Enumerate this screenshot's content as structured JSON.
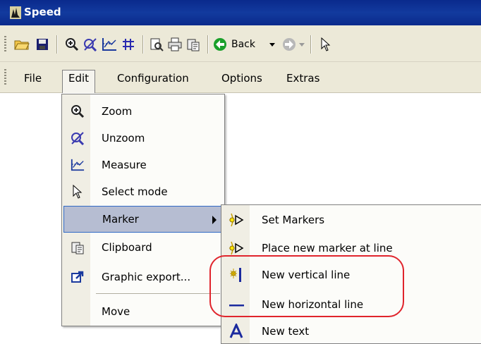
{
  "window": {
    "title": "Speed"
  },
  "toolbar": {
    "back_label": "Back",
    "icons": [
      "open-folder-icon",
      "save-icon",
      "zoom-in-icon",
      "unzoom-icon",
      "measure-icon",
      "grid-icon",
      "preview-icon",
      "print-icon",
      "clipboard-icon",
      "back-icon",
      "forward-icon",
      "pointer-icon"
    ]
  },
  "menubar": {
    "items": [
      "File",
      "Edit",
      "Configuration",
      "Options",
      "Extras"
    ],
    "open": "Edit"
  },
  "edit_menu": {
    "items": [
      {
        "label": "Zoom",
        "icon": "zoom-in-icon"
      },
      {
        "label": "Unzoom",
        "icon": "unzoom-icon"
      },
      {
        "label": "Measure",
        "icon": "measure-icon"
      },
      {
        "label": "Select mode",
        "icon": "pointer-icon"
      },
      {
        "label": "Marker",
        "icon": "",
        "submenu": true,
        "highlighted": true
      },
      {
        "label": "Clipboard",
        "icon": "clipboard-icon"
      },
      {
        "label": "Graphic export...",
        "icon": "export-icon"
      },
      {
        "label": "Move",
        "icon": ""
      }
    ]
  },
  "marker_submenu": {
    "items": [
      {
        "label": "Set Markers",
        "icon": "set-marker-icon"
      },
      {
        "label": "Place new marker at line",
        "icon": "place-marker-icon"
      },
      {
        "label": "New vertical line",
        "icon": "vertical-line-icon"
      },
      {
        "label": "New horizontal line",
        "icon": "horizontal-line-icon"
      },
      {
        "label": "New text",
        "icon": "text-icon"
      }
    ]
  },
  "colors": {
    "title_bar": "#0a2a8c",
    "menu_highlight": "#b6bdd2",
    "annotation": "#e0242c",
    "chrome": "#ece9d8"
  }
}
